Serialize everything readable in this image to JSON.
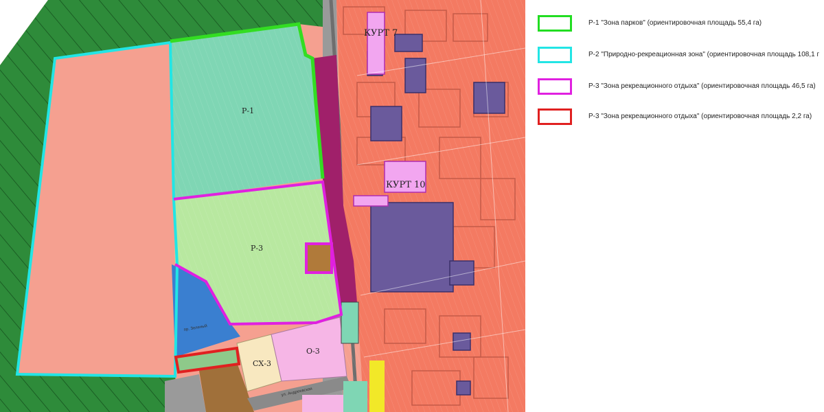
{
  "map": {
    "labels": {
      "kurt7": "КУРТ 7",
      "kurt10": "КУРТ 10",
      "p1": "Р-1",
      "p3": "Р-3",
      "cx3": "СХ-3",
      "o3": "О-3",
      "street_top": "пр. Зеленый",
      "street_bottom": "ул. Андреевская"
    },
    "colors": {
      "forest": "#2e8b3a",
      "park": "#7fd6b4",
      "recreation": "#b8e8a0",
      "residential": "#f47a62",
      "industrial": "#6a5a9c",
      "water": "#3a7fd0"
    }
  },
  "legend": {
    "items": [
      {
        "text": "Р-1 \"Зона парков\" (ориентировочная площадь 55,4 га)",
        "color": "#22dd22"
      },
      {
        "text": "Р-2 \"Природно-рекреационная зона\" (ориентировочная площадь 108,1 г",
        "color": "#22e5e5"
      },
      {
        "text": "Р-3 \"Зона рекреационного отдыха\" (ориентировочная площадь 46,5 га)",
        "color": "#e020e0"
      },
      {
        "text": "Р-3 \"Зона рекреационного отдыха\" (ориентировочная площадь 2,2 га)",
        "color": "#e02020"
      }
    ]
  }
}
